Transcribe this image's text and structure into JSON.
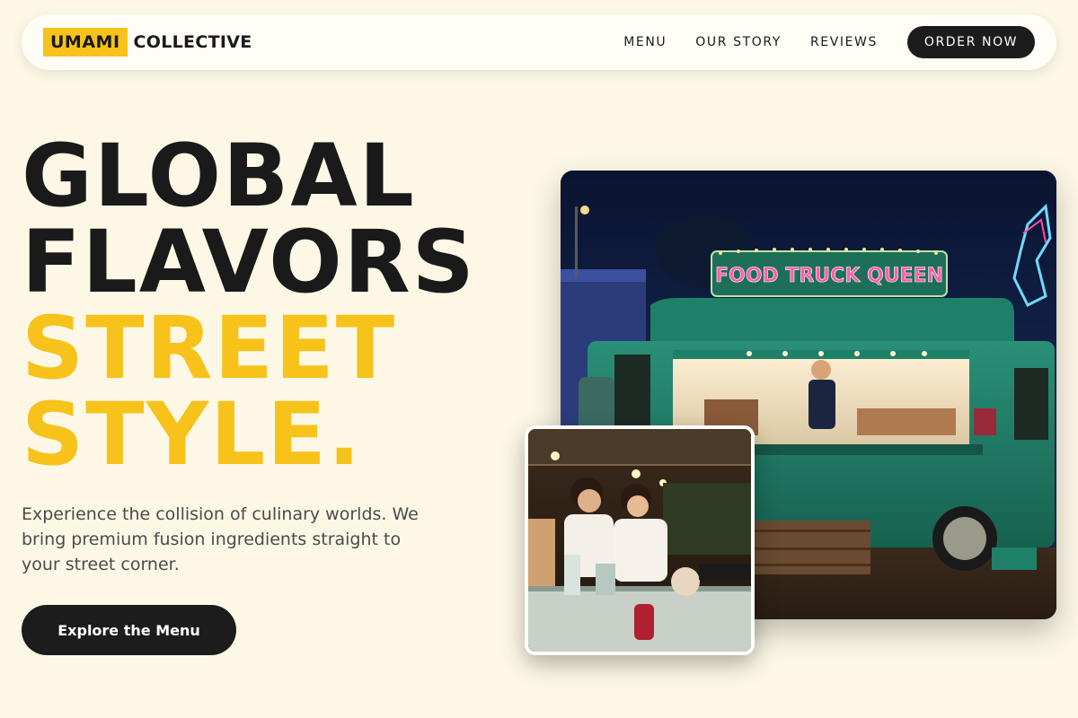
{
  "nav": {
    "logo_box": "UMAMI",
    "logo_text": "COLLECTIVE",
    "links": [
      "MENU",
      "OUR STORY",
      "REVIEWS"
    ],
    "order_label": "ORDER NOW"
  },
  "hero": {
    "line1": "GLOBAL",
    "line2": "FLAVORS",
    "line3": "STREET",
    "line4": "STYLE.",
    "subtext": "Experience the collision of culinary worlds. We bring premium fusion ingredients straight to your street corner.",
    "cta_label": "Explore the Menu"
  },
  "images": {
    "main_sign": "FOOD TRUCK QUEEN",
    "main_alt": "food-truck-photo",
    "inset_alt": "street-vendors-photo"
  },
  "colors": {
    "background": "#fdf8e6",
    "accent": "#f7c21a",
    "dark": "#1c1c1c",
    "truck": "#1f7a63"
  }
}
